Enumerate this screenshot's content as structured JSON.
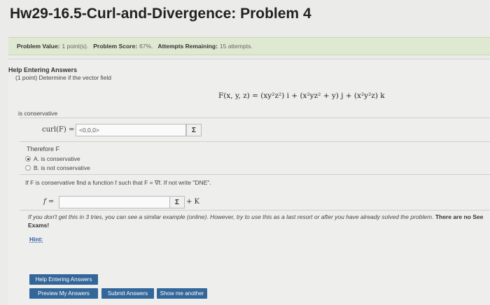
{
  "page": {
    "title": "Hw29-16.5-Curl-and-Divergence: Problem 4"
  },
  "info_bar": {
    "problem_value_label": "Problem Value:",
    "problem_value": "1 point(s).",
    "problem_score_label": "Problem Score:",
    "problem_score": "67%.",
    "attempts_label": "Attempts Remaining:",
    "attempts": "15 attempts."
  },
  "problem": {
    "help_heading": "Help Entering Answers",
    "question": "(1 point) Determine if the vector field",
    "vector_field": "F(x, y, z) = (xy²z²) i + (x²yz² + y) j + (x²y²z) k",
    "is_conservative": "is conservative",
    "curl_label": "curl(F) =",
    "curl_answer": "<0,0,0>",
    "sigma": "Σ",
    "therefore": "Therefore F",
    "choices": [
      {
        "label": "A. is conservative",
        "checked": true
      },
      {
        "label": "B. is not conservative",
        "checked": false
      }
    ],
    "find_function": "If F is conservative find a function f such that F = ∇f. If not write \"DNE\".",
    "f_label": "f =",
    "f_answer": "",
    "plus_k": "+ K",
    "warning": "If you don't get this in 3 tries, you can see a similar example (online). However, try to use this as a last resort or after you have already solved the problem.",
    "warning_bold": "There are no See Exams!",
    "hint": "Hint:"
  },
  "buttons": {
    "help_entering": "Help Entering Answers",
    "preview": "Preview My Answers",
    "submit": "Submit Answers",
    "show_another": "Show me another"
  }
}
